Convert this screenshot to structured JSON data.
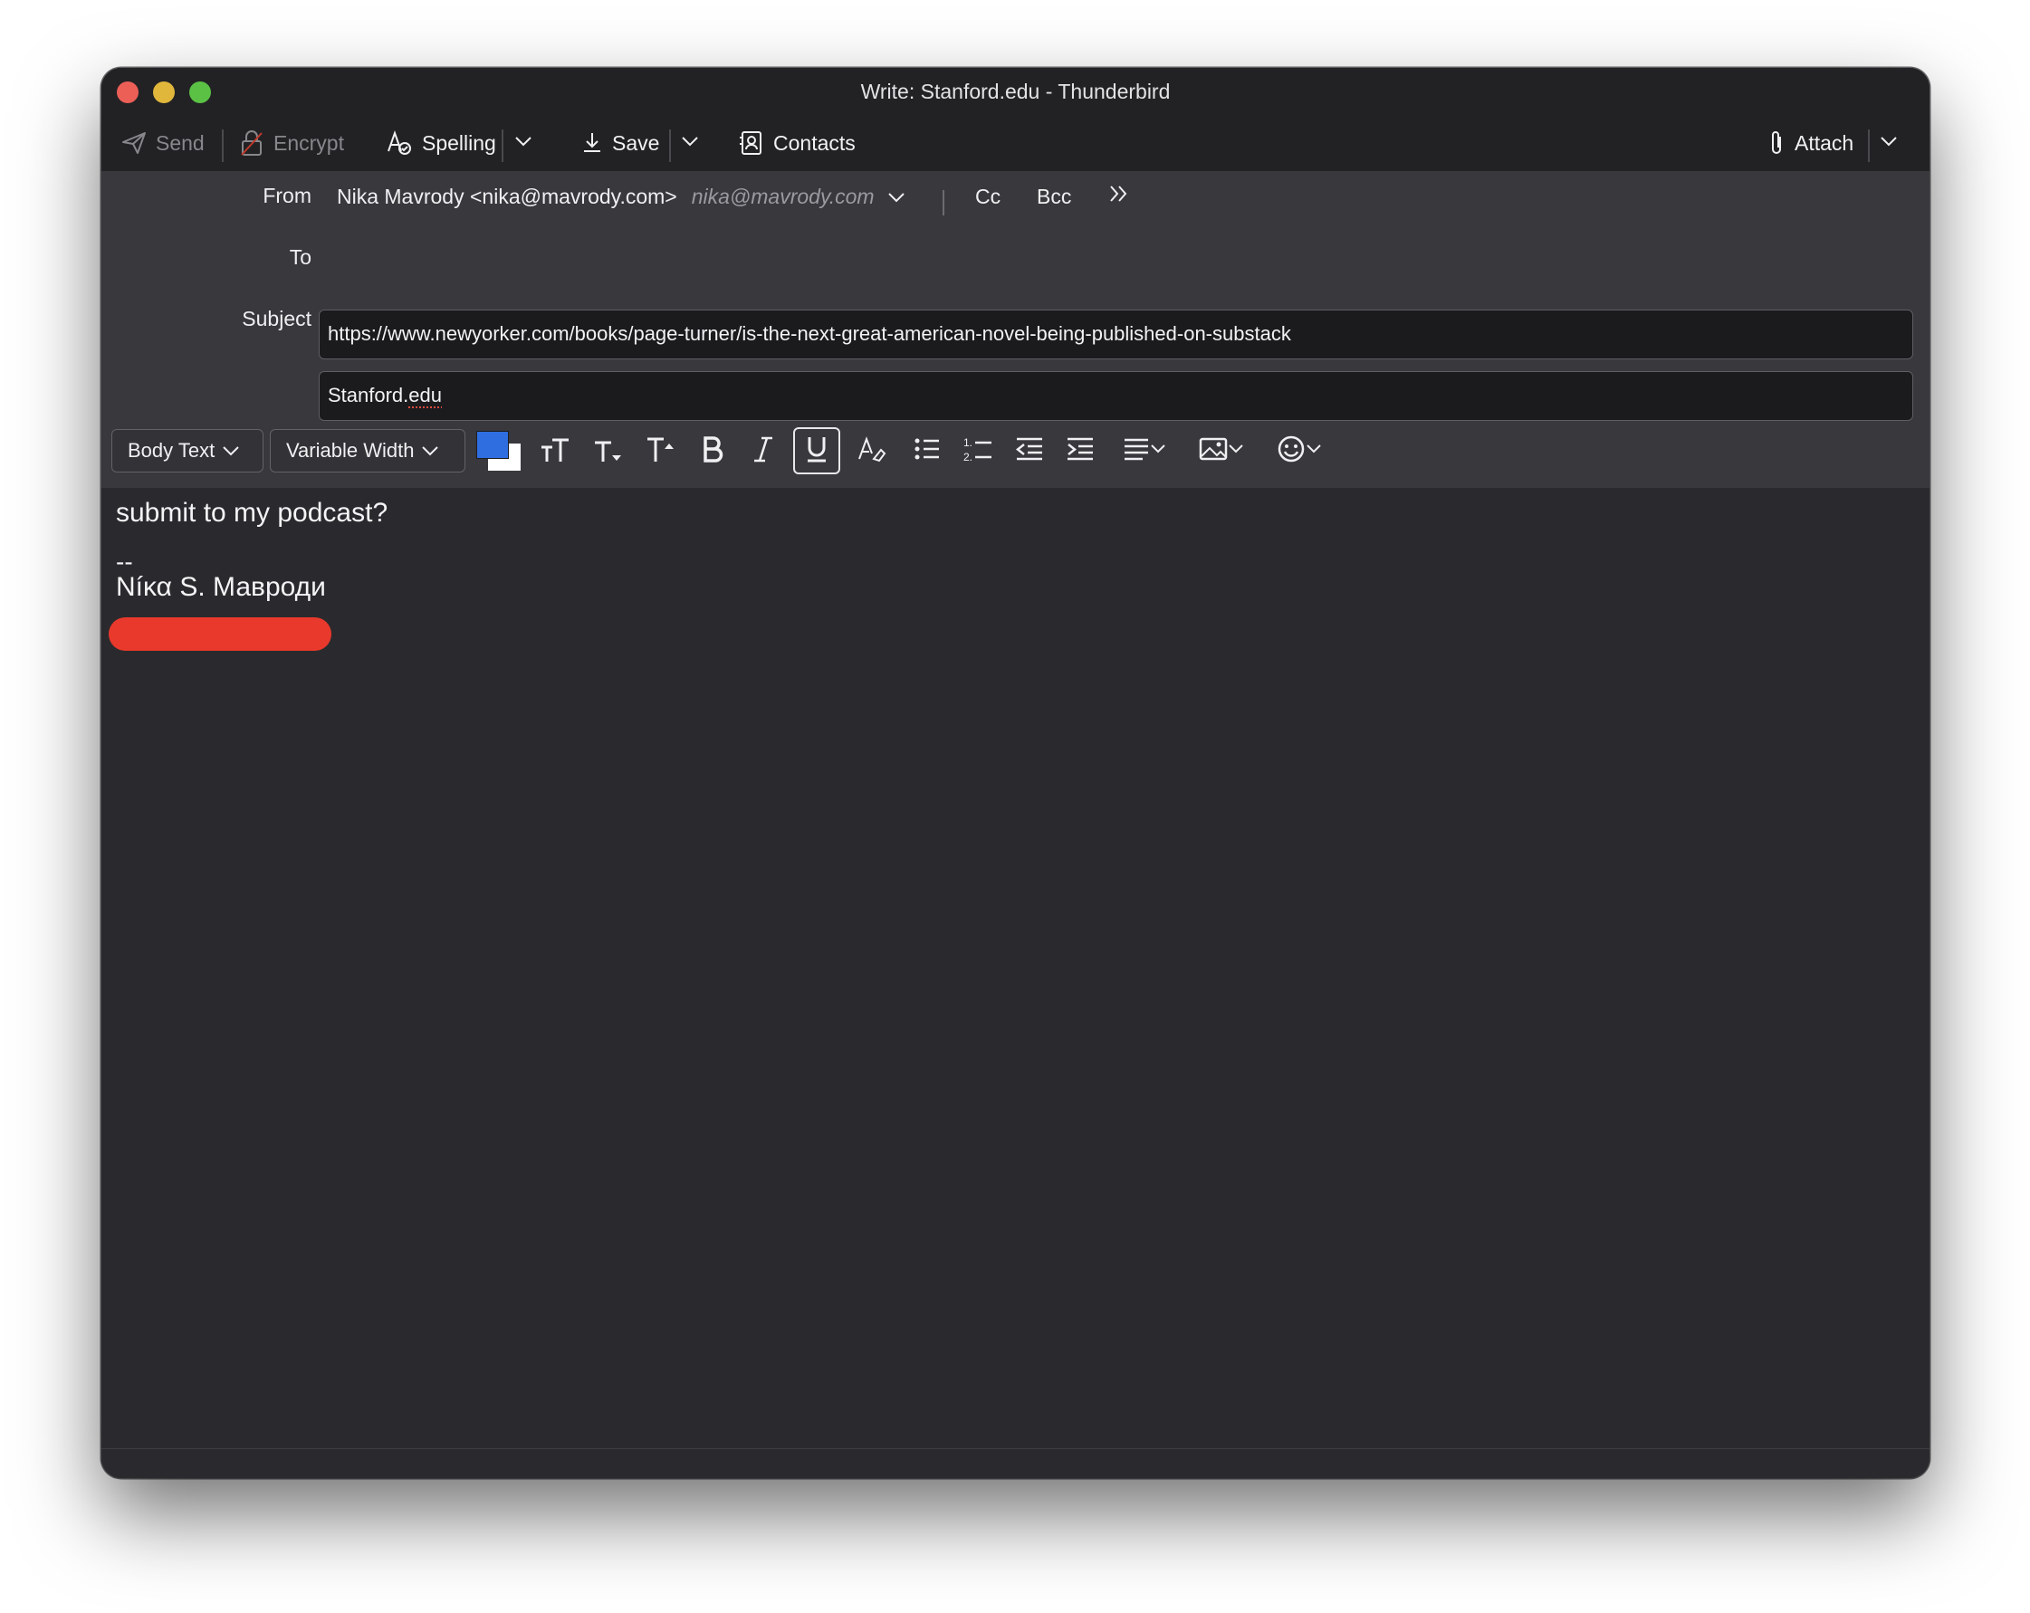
{
  "window": {
    "title": "Write: Stanford.edu - Thunderbird"
  },
  "toolbar": {
    "send_label": "Send",
    "encrypt_label": "Encrypt",
    "spelling_label": "Spelling",
    "save_label": "Save",
    "contacts_label": "Contacts",
    "attach_label": "Attach"
  },
  "headers": {
    "from_label": "From",
    "from_value": "Nika Mavrody <nika@mavrody.com>",
    "from_identity": "nika@mavrody.com",
    "cc_label": "Cc",
    "bcc_label": "Bcc",
    "to_label": "To",
    "to_value": "https://www.newyorker.com/books/page-turner/is-the-next-great-american-novel-being-published-on-substack",
    "subject_label": "Subject",
    "subject_value_1": "Stanford.",
    "subject_value_2": "edu"
  },
  "format": {
    "paragraph_style": "Body Text",
    "font": "Variable Width",
    "text_color": "#2f6ee0",
    "background_color": "#ffffff"
  },
  "message": {
    "line1": "submit to my podcast?",
    "sig_separator": "--",
    "sig_name": "Níκα S. Мавроди"
  },
  "colors": {
    "accent_redaction": "#e8392c",
    "window_bg": "#2a2a2e"
  }
}
